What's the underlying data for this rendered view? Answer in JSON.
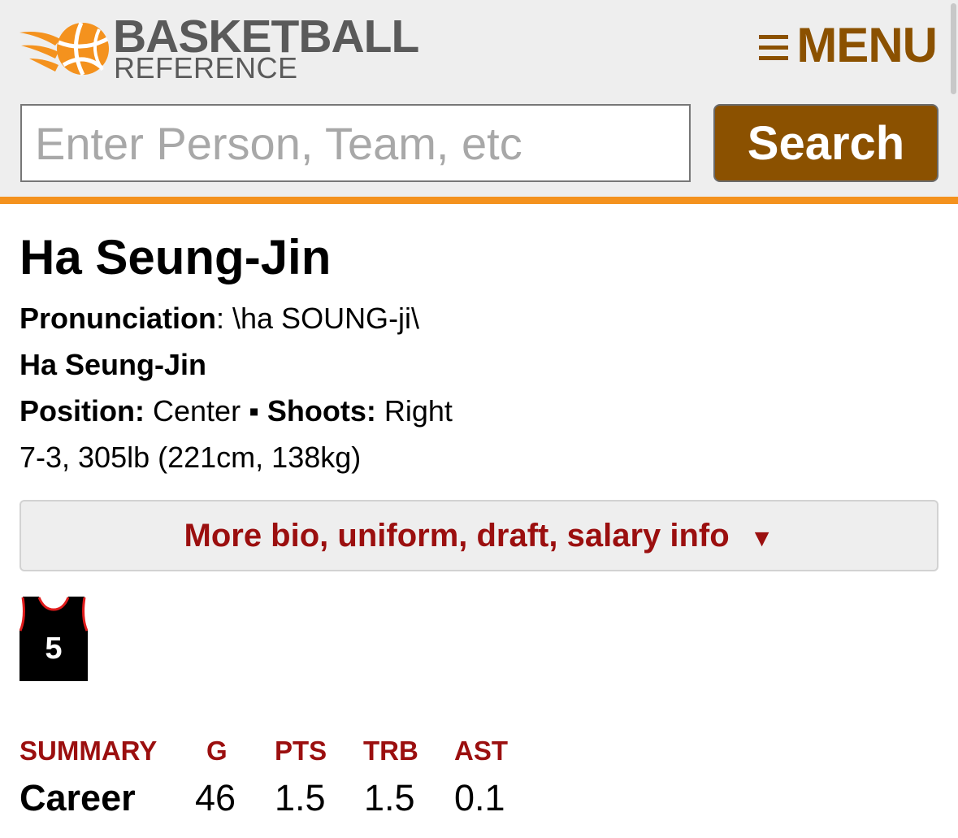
{
  "header": {
    "logo_line1": "BASKETBALL",
    "logo_line2": "REFERENCE",
    "menu_label": "MENU",
    "search": {
      "placeholder": "Enter Person, Team, etc",
      "button_label": "Search"
    },
    "colors": {
      "accent": "#f4921e",
      "brand": "#8b5100",
      "background": "#eeeeee"
    }
  },
  "player": {
    "name": "Ha Seung-Jin",
    "pronunciation_label": "Pronunciation",
    "pronunciation_value": ": \\ha SOUNG-ji\\",
    "full_name": "Ha Seung-Jin",
    "position_label": "Position:",
    "position_value": "Center",
    "separator": "▪",
    "shoots_label": "Shoots:",
    "shoots_value": "Right",
    "measurements": "7-3, 305lb (221cm, 138kg)",
    "more_info_label": "More bio, uniform, draft, salary info",
    "more_info_arrow": "▼",
    "jersey_number": "5"
  },
  "summary": {
    "headers": [
      "SUMMARY",
      "G",
      "PTS",
      "TRB",
      "AST"
    ],
    "rows": [
      {
        "label": "Career",
        "values": [
          "46",
          "1.5",
          "1.5",
          "0.1"
        ]
      }
    ],
    "header_color": "#9b0f0f"
  }
}
